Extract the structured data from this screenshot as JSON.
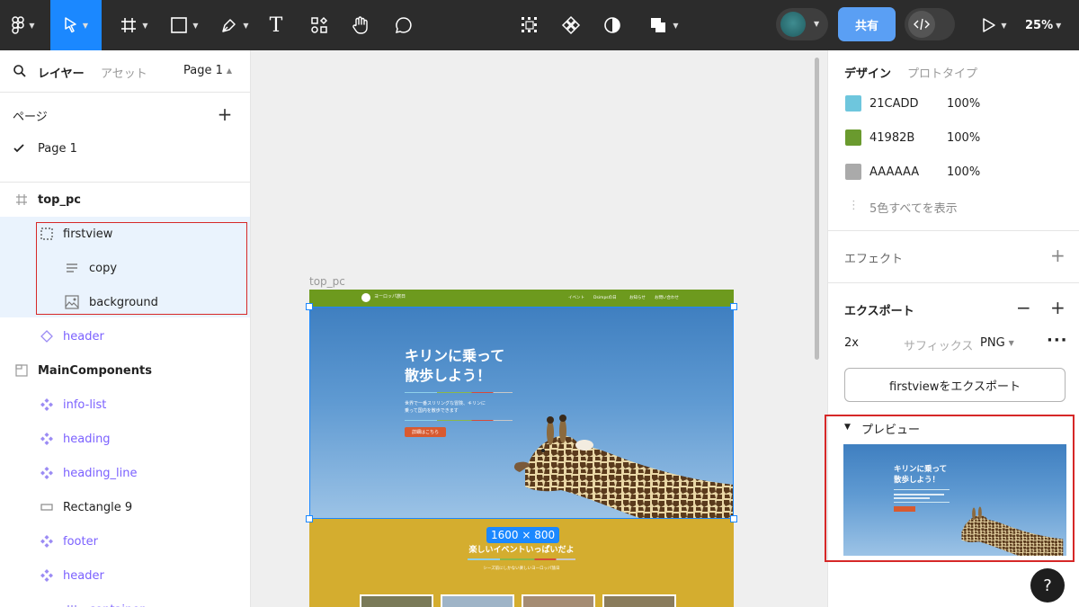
{
  "toolbar": {
    "share_label": "共有",
    "zoom_label": "25%",
    "text_tool_glyph": "T"
  },
  "left_panel": {
    "tab_layers": "レイヤー",
    "tab_assets": "アセット",
    "page_selector": "Page 1",
    "pages_heading": "ページ",
    "pages": [
      "Page 1"
    ],
    "layers": [
      {
        "label": "top_pc",
        "icon": "frame-icon"
      },
      {
        "label": "firstview",
        "icon": "section-icon"
      },
      {
        "label": "copy",
        "icon": "text-icon"
      },
      {
        "label": "background",
        "icon": "image-icon"
      },
      {
        "label": "header",
        "icon": "instance-icon"
      },
      {
        "label": "MainComponents",
        "icon": "section-icon"
      },
      {
        "label": "info-list",
        "icon": "component-icon"
      },
      {
        "label": "heading",
        "icon": "component-icon"
      },
      {
        "label": "heading_line",
        "icon": "component-icon"
      },
      {
        "label": "Rectangle 9",
        "icon": "rectangle-icon"
      },
      {
        "label": "footer",
        "icon": "component-icon"
      },
      {
        "label": "header",
        "icon": "component-icon"
      },
      {
        "label": "container",
        "icon": "auto-layout-icon"
      }
    ]
  },
  "canvas": {
    "frame_label": "top_pc",
    "size_badge": "1600 × 800",
    "site": {
      "logo_text": "ヨーロッパ旅日",
      "nav": [
        "イベント",
        "Dsimpsの日",
        "お知らせ",
        "お問い合わせ"
      ],
      "hero_title_line1": "キリンに乗って",
      "hero_title_line2": "散歩しよう！",
      "hero_sub_line1": "世界で一番スリリングな冒険、キリンに",
      "hero_sub_line2": "乗って国内を散歩できます",
      "hero_button": "詳細はこちら",
      "section_title": "楽しいイベントいっぱいだよ",
      "section_sub": "シーズ前にしかない楽しいヨーロッパ旅日"
    }
  },
  "right_panel": {
    "tab_design": "デザイン",
    "tab_prototype": "プロトタイプ",
    "colors": [
      {
        "hex": "21CADD",
        "opacity": "100%",
        "swatch": "#6ec6dd"
      },
      {
        "hex": "41982B",
        "opacity": "100%",
        "swatch": "#6a9a2e"
      },
      {
        "hex": "AAAAAA",
        "opacity": "100%",
        "swatch": "#aaaaaa"
      }
    ],
    "show_all_colors": "5色すべてを表示",
    "effects_label": "エフェクト",
    "export_label": "エクスポート",
    "export_scale": "2x",
    "export_suffix_placeholder": "サフィックス",
    "export_format": "PNG",
    "export_button": "firstviewをエクスポート",
    "preview_label": "プレビュー",
    "preview_title_line1": "キリンに乗って",
    "preview_title_line2": "散歩しよう！"
  },
  "help_label": "?"
}
